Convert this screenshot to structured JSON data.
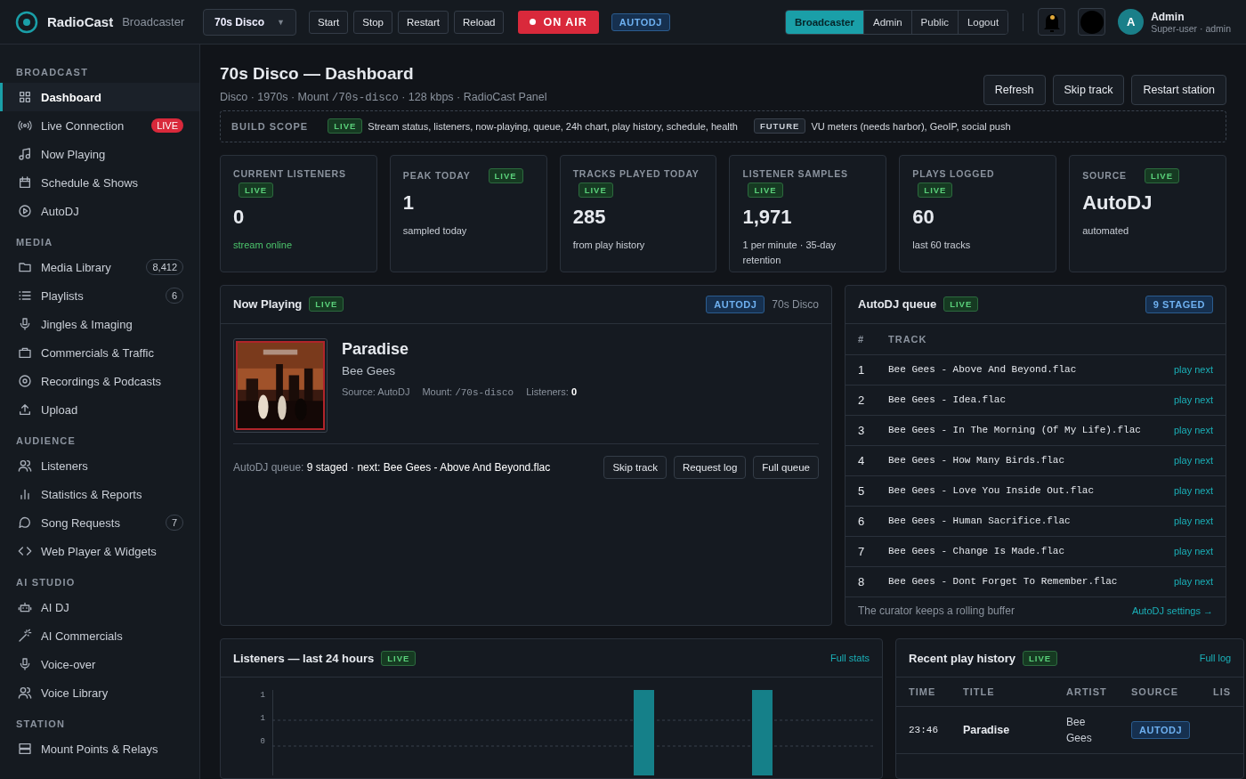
{
  "brand": {
    "name": "RadioCast",
    "sub": "Broadcaster"
  },
  "topbar": {
    "station": "70s Disco",
    "caret": "▼",
    "actions": [
      "Start",
      "Stop",
      "Restart",
      "Reload"
    ],
    "on_air": {
      "label": "ON AIR",
      "on": true
    },
    "mode": "AUTODJ",
    "roles": [
      {
        "label": "Broadcaster",
        "selected": true
      },
      {
        "label": "Admin",
        "selected": false
      },
      {
        "label": "Public",
        "selected": false
      },
      {
        "label": "Logout",
        "selected": false
      }
    ],
    "alert": true,
    "user": {
      "initial": "A",
      "name": "Admin",
      "role": "Super-user · admin"
    }
  },
  "sidebar": [
    {
      "title": "BROADCAST",
      "items": [
        {
          "label": "Dashboard",
          "selected": true
        },
        {
          "label": "Live Connection",
          "selected": false,
          "badge": "LIVE",
          "kind": "live"
        },
        {
          "label": "Now Playing",
          "selected": false
        },
        {
          "label": "Schedule & Shows",
          "selected": false
        },
        {
          "label": "AutoDJ",
          "selected": false
        }
      ]
    },
    {
      "title": "MEDIA",
      "items": [
        {
          "label": "Media Library",
          "selected": false,
          "badge": "8,412",
          "kind": "count"
        },
        {
          "label": "Playlists",
          "selected": false,
          "badge": "6",
          "kind": "count"
        },
        {
          "label": "Jingles & Imaging",
          "selected": false
        },
        {
          "label": "Commercials & Traffic",
          "selected": false
        },
        {
          "label": "Recordings & Podcasts",
          "selected": false
        },
        {
          "label": "Upload",
          "selected": false
        }
      ]
    },
    {
      "title": "AUDIENCE",
      "items": [
        {
          "label": "Listeners",
          "selected": false
        },
        {
          "label": "Statistics & Reports",
          "selected": false
        },
        {
          "label": "Song Requests",
          "selected": false,
          "badge": "7",
          "kind": "count"
        },
        {
          "label": "Web Player & Widgets",
          "selected": false
        }
      ]
    },
    {
      "title": "AI STUDIO",
      "items": [
        {
          "label": "AI DJ",
          "selected": false
        },
        {
          "label": "AI Commercials",
          "selected": false
        },
        {
          "label": "Voice-over",
          "selected": false
        },
        {
          "label": "Voice Library",
          "selected": false
        }
      ]
    },
    {
      "title": "STATION",
      "items": [
        {
          "label": "Mount Points & Relays",
          "selected": false
        }
      ]
    }
  ],
  "page": {
    "title": "70s Disco — Dashboard",
    "subtitle": [
      {
        "text": "Disco · 1970s · Mount ",
        "kind": "plain"
      },
      {
        "text": "/70s-disco",
        "kind": "mono"
      },
      {
        "text": " · 128 kbps · RadioCast Panel",
        "kind": "plain"
      }
    ],
    "actions": [
      "Refresh",
      "Skip track",
      "Restart station"
    ]
  },
  "scope": {
    "label": "BUILD SCOPE",
    "items": [
      {
        "tag": "LIVE",
        "kind": "live",
        "text": "Stream status, listeners, now-playing, queue, 24h chart, play history, schedule, health"
      },
      {
        "tag": "FUTURE",
        "kind": "future",
        "text": "VU meters (needs harbor), GeoIP, social push"
      }
    ]
  },
  "stats": [
    {
      "label": "CURRENT LISTENERS",
      "tag": "LIVE",
      "value": "0",
      "note": "stream online",
      "note_ok": true
    },
    {
      "label": "PEAK TODAY",
      "tag": "LIVE",
      "value": "1",
      "note": "sampled today",
      "note_ok": false
    },
    {
      "label": "TRACKS PLAYED TODAY",
      "tag": "LIVE",
      "value": "285",
      "note": "from play history",
      "note_ok": false
    },
    {
      "label": "LISTENER SAMPLES",
      "tag": "LIVE",
      "value": "1,971",
      "note": "1 per minute · 35-day retention",
      "note_ok": false
    },
    {
      "label": "PLAYS LOGGED",
      "tag": "LIVE",
      "value": "60",
      "note": "last 60 tracks",
      "note_ok": false
    },
    {
      "label": "SOURCE",
      "tag": "LIVE",
      "value": "AutoDJ",
      "note": "automated",
      "note_ok": false
    }
  ],
  "now_playing": {
    "title": "Now Playing",
    "tag": "LIVE",
    "source_badge": "AUTODJ",
    "station": "70s Disco",
    "art": {
      "kind": "picture"
    },
    "track": "Paradise",
    "artist": "Bee Gees",
    "meta": [
      {
        "label": "Source: ",
        "value": "AutoDJ",
        "kind": "plain"
      },
      {
        "label": "Mount: ",
        "value": "/70s-disco",
        "kind": "mono"
      },
      {
        "label": "Listeners: ",
        "value": "0",
        "kind": "bold"
      }
    ],
    "queue_label": "AutoDJ queue:",
    "queue_text": "9 staged · next: Bee Gees - Above And Beyond.flac",
    "buttons": [
      "Skip track",
      "Request log",
      "Full queue"
    ]
  },
  "queue": {
    "title": "AutoDJ queue",
    "tag": "LIVE",
    "count": "9 STAGED",
    "columns": [
      "#",
      "TRACK"
    ],
    "rows": [
      {
        "n": "1",
        "track": "Bee Gees - Above And Beyond.flac",
        "action": "play next"
      },
      {
        "n": "2",
        "track": "Bee Gees - Idea.flac",
        "action": "play next"
      },
      {
        "n": "3",
        "track": "Bee Gees - In The Morning (Of My Life).flac",
        "action": "play next"
      },
      {
        "n": "4",
        "track": "Bee Gees - How Many Birds.flac",
        "action": "play next"
      },
      {
        "n": "5",
        "track": "Bee Gees - Love You Inside Out.flac",
        "action": "play next"
      },
      {
        "n": "6",
        "track": "Bee Gees - Human Sacrifice.flac",
        "action": "play next"
      },
      {
        "n": "7",
        "track": "Bee Gees - Change Is Made.flac",
        "action": "play next"
      },
      {
        "n": "8",
        "track": "Bee Gees - Dont Forget To Remember.flac",
        "action": "play next"
      }
    ],
    "footer": "The curator keeps a rolling buffer",
    "link": "AutoDJ settings →"
  },
  "listeners_chart": {
    "title": "Listeners — last 24 hours",
    "tag": "LIVE",
    "link": "Full stats",
    "y_labels": [
      "1",
      "1",
      "0"
    ]
  },
  "history": {
    "title": "Recent play history",
    "tag": "LIVE",
    "link": "Full log",
    "columns": [
      "TIME",
      "TITLE",
      "ARTIST",
      "SOURCE",
      "LIS"
    ],
    "rows": [
      {
        "time": "23:46",
        "title": "Paradise",
        "artist": "Bee Gees",
        "source": "AUTODJ"
      }
    ]
  }
}
